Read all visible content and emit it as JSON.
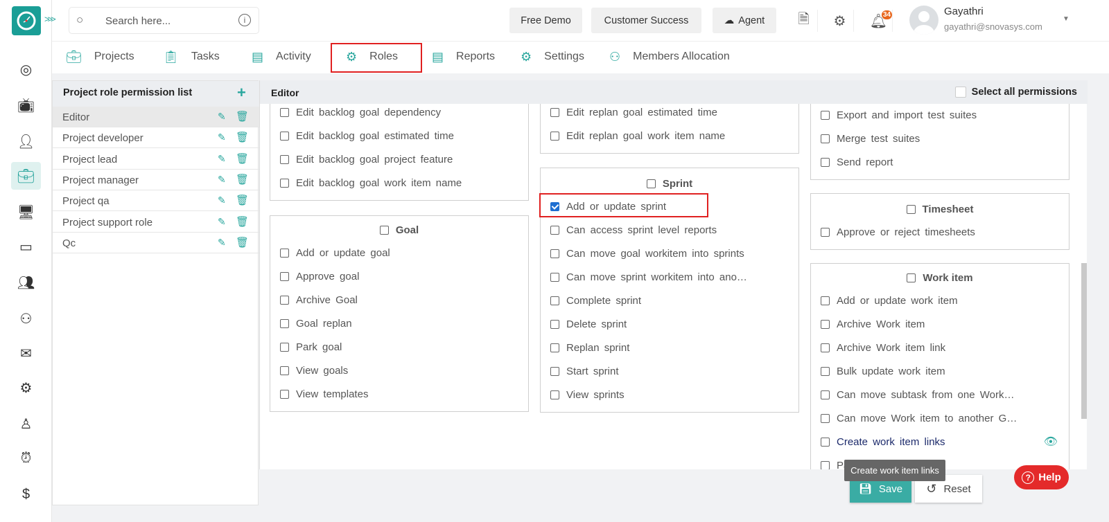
{
  "search": {
    "placeholder": "Search here..."
  },
  "header": {
    "buttons": [
      "Free Demo",
      "Customer Success",
      "Agent"
    ],
    "notifications": "34",
    "user": {
      "name": "Gayathri",
      "email": "gayathri@snovasys.com"
    }
  },
  "tabs": [
    {
      "label": "Projects",
      "icon": "briefcase-icon"
    },
    {
      "label": "Tasks",
      "icon": "clipboard-icon"
    },
    {
      "label": "Activity",
      "icon": "list-icon"
    },
    {
      "label": "Roles",
      "icon": "gear-icon",
      "active": true
    },
    {
      "label": "Reports",
      "icon": "report-icon"
    },
    {
      "label": "Settings",
      "icon": "settings-icon"
    },
    {
      "label": "Members Allocation",
      "icon": "members-icon"
    }
  ],
  "roles": {
    "title": "Project role permission list",
    "items": [
      "Editor",
      "Project developer",
      "Project lead",
      "Project manager",
      "Project qa",
      "Project support role",
      "Qc"
    ],
    "selected": "Editor"
  },
  "permissions": {
    "title": "Editor",
    "select_all": "Select all permissions",
    "columns": [
      [
        {
          "title": "",
          "items": [
            "Edit backlog goal dependency",
            "Edit backlog goal estimated time",
            "Edit backlog goal project feature",
            "Edit backlog goal work item name"
          ]
        },
        {
          "title": "Goal",
          "items": [
            "Add or update goal",
            "Approve goal",
            "Archive Goal",
            "Goal replan",
            "Park goal",
            "View goals",
            "View templates"
          ]
        }
      ],
      [
        {
          "title": "",
          "items": [
            "Edit replan goal estimated time",
            "Edit replan goal work item name"
          ]
        },
        {
          "title": "Sprint",
          "items": [
            "Add or update sprint",
            "Can access sprint level reports",
            "Can move goal workitem into sprints",
            "Can move sprint workitem into ano…",
            "Complete sprint",
            "Delete sprint",
            "Replan sprint",
            "Start sprint",
            "View sprints"
          ],
          "checked": [
            "Add or update sprint"
          ]
        }
      ],
      [
        {
          "title": "",
          "items": [
            "Export and import test suites",
            "Merge test suites",
            "Send report"
          ]
        },
        {
          "title": "Timesheet",
          "items": [
            "Approve or reject timesheets"
          ]
        },
        {
          "title": "Work item",
          "items": [
            "Add or update work item",
            "Archive Work item",
            "Archive Work item link",
            "Bulk update work item",
            "Can move subtask from one Work…",
            "Can move Work item to another G…",
            "Create work item links",
            "Park work item"
          ],
          "hovered": "Create work item links"
        }
      ]
    ]
  },
  "tooltip": "Create work item links",
  "actions": {
    "save": "Save",
    "reset": "Reset",
    "help": "Help"
  },
  "colors": {
    "accent": "#2aa79e",
    "highlight": "#e02020",
    "help": "#e42a2a"
  }
}
